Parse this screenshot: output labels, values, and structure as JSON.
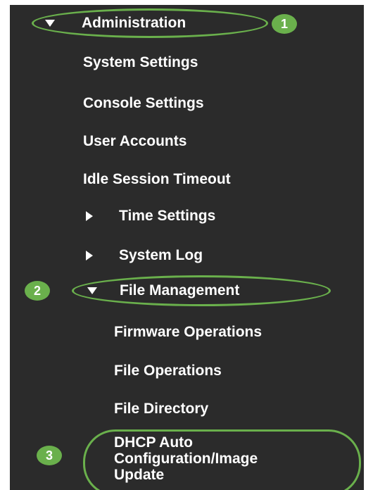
{
  "menu": {
    "administration": "Administration",
    "system_settings": "System Settings",
    "console_settings": "Console Settings",
    "user_accounts": "User Accounts",
    "idle_session_timeout": "Idle Session Timeout",
    "time_settings": "Time Settings",
    "system_log": "System Log",
    "file_management": "File Management",
    "firmware_operations": "Firmware Operations",
    "file_operations": "File Operations",
    "file_directory": "File Directory",
    "dhcp_line1": "DHCP Auto",
    "dhcp_line2": "Configuration/Image",
    "dhcp_line3": "Update"
  },
  "callouts": {
    "one": "1",
    "two": "2",
    "three": "3"
  },
  "colors": {
    "panel_background": "#2b2b2b",
    "text": "#ffffff",
    "callout_green": "#6ab04c"
  }
}
